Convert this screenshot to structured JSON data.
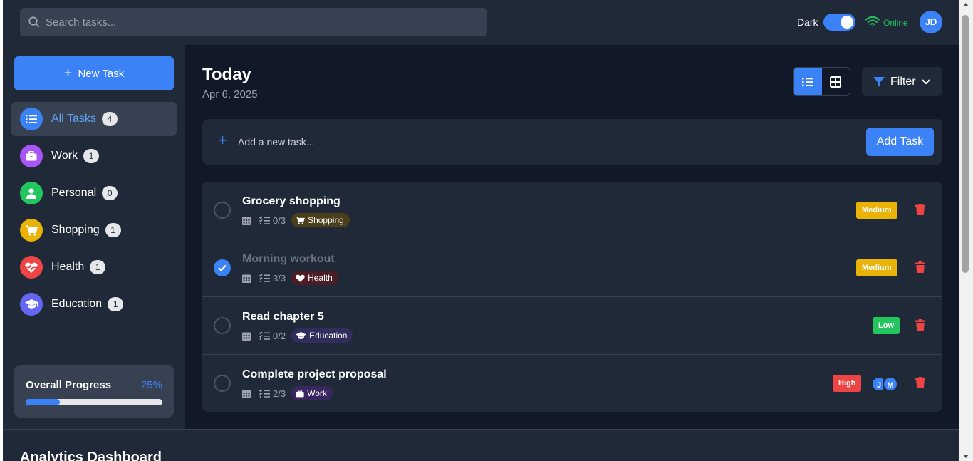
{
  "header": {
    "search_placeholder": "Search tasks...",
    "theme_label": "Dark",
    "connection_status": "Online",
    "user_initials": "JD"
  },
  "sidebar": {
    "new_task_label": "New Task",
    "categories": [
      {
        "label": "All Tasks",
        "count": "4",
        "icon": "list-icon",
        "color": "#3b82f6",
        "active": true
      },
      {
        "label": "Work",
        "count": "1",
        "icon": "briefcase-icon",
        "color": "#a855f7"
      },
      {
        "label": "Personal",
        "count": "0",
        "icon": "user-icon",
        "color": "#22c55e"
      },
      {
        "label": "Shopping",
        "count": "1",
        "icon": "cart-icon",
        "color": "#eab308"
      },
      {
        "label": "Health",
        "count": "1",
        "icon": "heartbeat-icon",
        "color": "#ef4444"
      },
      {
        "label": "Education",
        "count": "1",
        "icon": "graduation-cap-icon",
        "color": "#6366f1"
      }
    ],
    "progress": {
      "label": "Overall Progress",
      "percent_text": "25%",
      "value": 0.25
    }
  },
  "main": {
    "title": "Today",
    "date": "Apr 6, 2025",
    "filter_label": "Filter",
    "add_placeholder": "Add a new task...",
    "add_button": "Add Task",
    "tasks": [
      {
        "name": "Grocery shopping",
        "done": false,
        "subtasks": "0/3",
        "tag": "Shopping",
        "tag_icon": "cart-icon",
        "priority": "Medium"
      },
      {
        "name": "Morning workout",
        "done": true,
        "subtasks": "3/3",
        "tag": "Health",
        "tag_icon": "heartbeat-icon",
        "priority": "Medium"
      },
      {
        "name": "Read chapter 5",
        "done": false,
        "subtasks": "0/2",
        "tag": "Education",
        "tag_icon": "graduation-cap-icon",
        "priority": "Low"
      },
      {
        "name": "Complete project proposal",
        "done": false,
        "subtasks": "2/3",
        "tag": "Work",
        "tag_icon": "briefcase-icon",
        "priority": "High",
        "assignees": [
          "J",
          "M"
        ]
      }
    ]
  },
  "analytics": {
    "title": "Analytics Dashboard"
  },
  "colors": {
    "accent": "#3b82f6",
    "priority_medium": "#eab308",
    "priority_low": "#22c55e",
    "priority_high": "#ef4444",
    "delete": "#ef4444"
  }
}
